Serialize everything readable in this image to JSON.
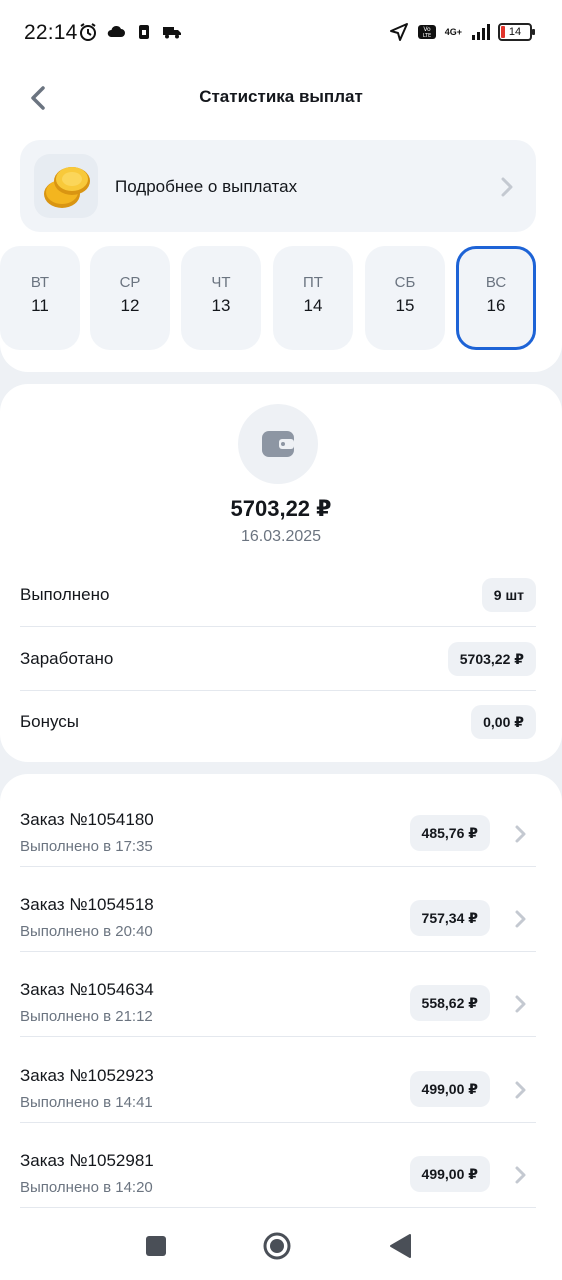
{
  "status_bar": {
    "time": "22:14",
    "network": "4G+",
    "battery": "14",
    "icons": [
      "alarm-icon",
      "cloud-icon",
      "sim-icon",
      "truck-icon",
      "location-icon",
      "volte-icon",
      "signal-icon",
      "battery-icon"
    ]
  },
  "header": {
    "title": "Статистика выплат",
    "back_icon": "chevron-left-icon"
  },
  "info_card": {
    "label": "Подробнее о выплатах",
    "icon": "coin-icon"
  },
  "days": [
    {
      "name": "ВТ",
      "num": "11",
      "selected": false
    },
    {
      "name": "СР",
      "num": "12",
      "selected": false
    },
    {
      "name": "ЧТ",
      "num": "13",
      "selected": false
    },
    {
      "name": "ПТ",
      "num": "14",
      "selected": false
    },
    {
      "name": "СБ",
      "num": "15",
      "selected": false
    },
    {
      "name": "ВС",
      "num": "16",
      "selected": true
    }
  ],
  "summary": {
    "icon": "wallet-icon",
    "total": "5703,22 ₽",
    "date": "16.03.2025",
    "rows": [
      {
        "label": "Выполнено",
        "value": "9 шт"
      },
      {
        "label": "Заработано",
        "value": "5703,22 ₽"
      },
      {
        "label": "Бонусы",
        "value": "0,00 ₽"
      }
    ]
  },
  "orders": [
    {
      "title": "Заказ №1054180",
      "sub": "Выполнено в 17:35",
      "amount": "485,76 ₽"
    },
    {
      "title": "Заказ №1054518",
      "sub": "Выполнено в 20:40",
      "amount": "757,34 ₽"
    },
    {
      "title": "Заказ №1054634",
      "sub": "Выполнено в 21:12",
      "amount": "558,62 ₽"
    },
    {
      "title": "Заказ №1052923",
      "sub": "Выполнено в 14:41",
      "amount": "499,00 ₽"
    },
    {
      "title": "Заказ №1052981",
      "sub": "Выполнено в 14:20",
      "amount": "499,00 ₽"
    }
  ],
  "colors": {
    "accent": "#1d63d6",
    "background": "#eef1f5",
    "card": "#ffffff",
    "muted_text": "#6b7480"
  }
}
